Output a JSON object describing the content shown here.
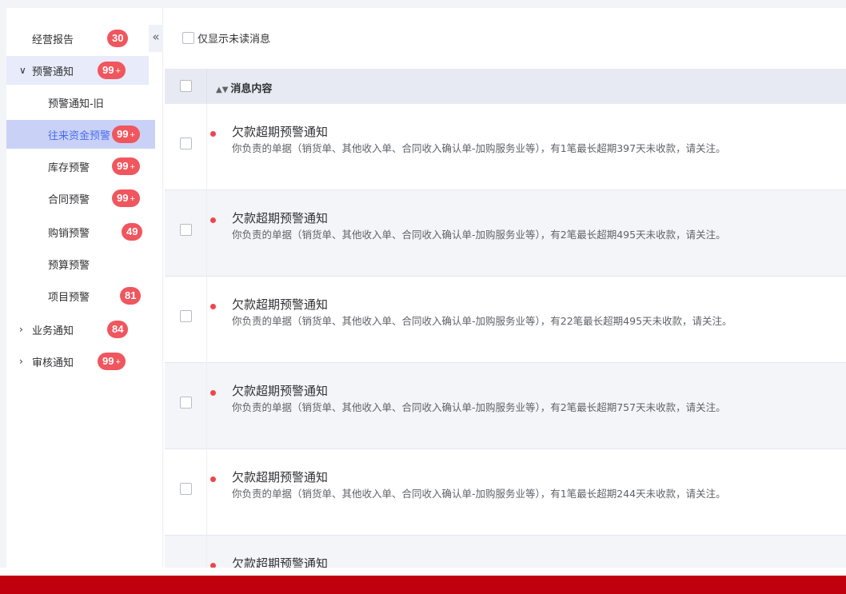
{
  "sidebar": {
    "collapse_glyph": "«",
    "items": [
      {
        "label": "经营报告",
        "badge": "30",
        "badge_plus": ""
      },
      {
        "label": "预警通知",
        "badge": "99",
        "badge_plus": "+",
        "arrow": "∨"
      },
      {
        "label": "预警通知-旧",
        "badge": "",
        "badge_plus": ""
      },
      {
        "label": "往来资金预警",
        "badge": "99",
        "badge_plus": "+"
      },
      {
        "label": "库存预警",
        "badge": "99",
        "badge_plus": "+"
      },
      {
        "label": "合同预警",
        "badge": "99",
        "badge_plus": "+"
      },
      {
        "label": "购销预警",
        "badge": "49",
        "badge_plus": ""
      },
      {
        "label": "预算预警",
        "badge": "",
        "badge_plus": ""
      },
      {
        "label": "项目预警",
        "badge": "81",
        "badge_plus": ""
      },
      {
        "label": "业务通知",
        "badge": "84",
        "badge_plus": "",
        "arrow": "›"
      },
      {
        "label": "审核通知",
        "badge": "99",
        "badge_plus": "+",
        "arrow": "›"
      }
    ]
  },
  "filter": {
    "label": "仅显示未读消息"
  },
  "table": {
    "header": "消息内容",
    "sort_glyph": "▲▼",
    "rows": [
      {
        "title": "欠款超期预警通知",
        "desc": "你负责的单据（销货单、其他收入单、合同收入确认单-加购服务业等），有1笔最长超期397天未收款，请关注。"
      },
      {
        "title": "欠款超期预警通知",
        "desc": "你负责的单据（销货单、其他收入单、合同收入确认单-加购服务业等），有2笔最长超期495天未收款，请关注。"
      },
      {
        "title": "欠款超期预警通知",
        "desc": "你负责的单据（销货单、其他收入单、合同收入确认单-加购服务业等），有22笔最长超期495天未收款，请关注。"
      },
      {
        "title": "欠款超期预警通知",
        "desc": "你负责的单据（销货单、其他收入单、合同收入确认单-加购服务业等），有2笔最长超期757天未收款，请关注。"
      },
      {
        "title": "欠款超期预警通知",
        "desc": "你负责的单据（销货单、其他收入单、合同收入确认单-加购服务业等），有1笔最长超期244天未收款，请关注。"
      },
      {
        "title": "欠款超期预警通知",
        "desc": ""
      }
    ]
  },
  "colors": {
    "accent": "#4b6cf0",
    "badge": "#f0565e",
    "unread_dot": "#f0444c",
    "bottom_bar": "#c0000c"
  }
}
